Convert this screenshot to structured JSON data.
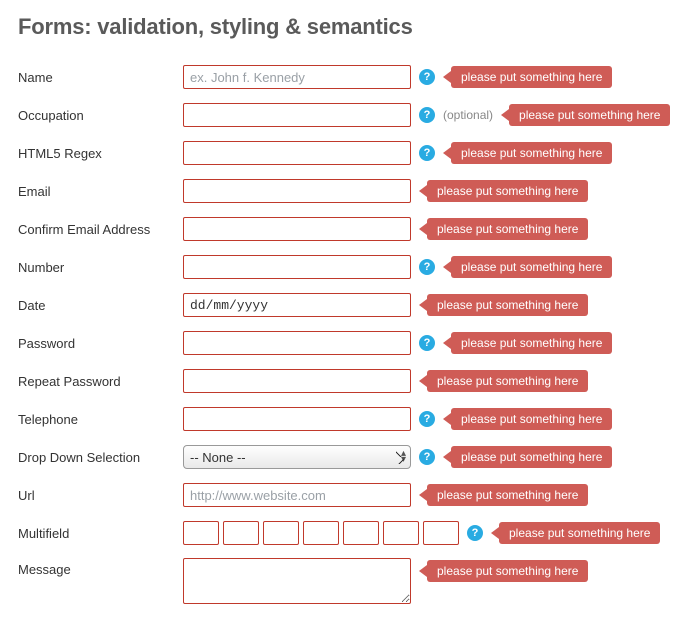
{
  "title": "Forms: validation, styling & semantics",
  "error_text": "please put something here",
  "optional_text": "(optional)",
  "help_glyph": "?",
  "fields": {
    "name": {
      "label": "Name",
      "placeholder": "ex. John f. Kennedy",
      "help": true
    },
    "occupation": {
      "label": "Occupation",
      "placeholder": "",
      "help": true,
      "optional": true
    },
    "regex": {
      "label": "HTML5 Regex",
      "placeholder": "",
      "help": true
    },
    "email": {
      "label": "Email",
      "placeholder": "",
      "help": false
    },
    "email2": {
      "label": "Confirm Email Address",
      "placeholder": "",
      "help": false
    },
    "number": {
      "label": "Number",
      "placeholder": "",
      "help": true
    },
    "date": {
      "label": "Date",
      "value": "dd/mm/yyyy",
      "help": false
    },
    "password": {
      "label": "Password",
      "placeholder": "",
      "help": true
    },
    "password2": {
      "label": "Repeat Password",
      "placeholder": "",
      "help": false
    },
    "telephone": {
      "label": "Telephone",
      "placeholder": "",
      "help": true
    },
    "dropdown": {
      "label": "Drop Down Selection",
      "value": "-- None --",
      "help": true
    },
    "url": {
      "label": "Url",
      "placeholder": "http://www.website.com",
      "help": false
    },
    "multifield": {
      "label": "Multifield",
      "count": 7,
      "help": true
    },
    "message": {
      "label": "Message",
      "placeholder": "",
      "help": false
    }
  }
}
